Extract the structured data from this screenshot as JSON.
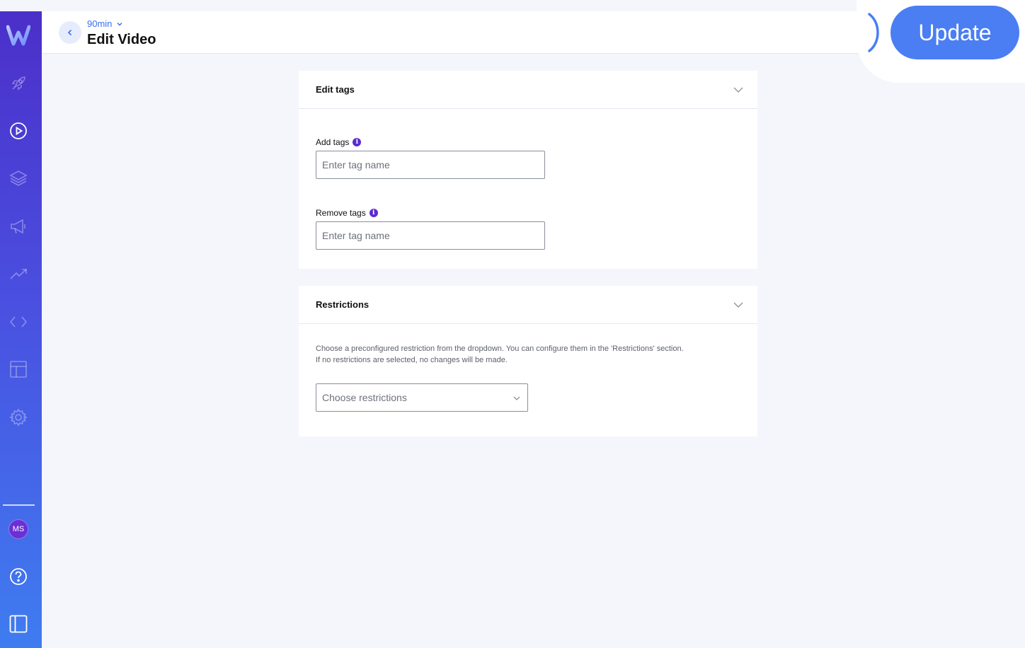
{
  "header": {
    "project": "90min",
    "title": "Edit Video"
  },
  "actions": {
    "update_label": "Update"
  },
  "sidebar": {
    "items": [
      {
        "icon": "rocket-icon"
      },
      {
        "icon": "play-circle-icon",
        "active": true
      },
      {
        "icon": "layers-icon"
      },
      {
        "icon": "megaphone-icon"
      },
      {
        "icon": "trending-up-icon"
      },
      {
        "icon": "code-icon"
      },
      {
        "icon": "layout-icon"
      },
      {
        "icon": "gear-icon"
      }
    ],
    "user_initials": "MS",
    "help_icon": "help-circle-icon",
    "panel_icon": "sidebar-panel-icon"
  },
  "edit_tags": {
    "title": "Edit tags",
    "add_label": "Add tags",
    "add_placeholder": "Enter tag name",
    "remove_label": "Remove tags",
    "remove_placeholder": "Enter tag name"
  },
  "restrictions": {
    "title": "Restrictions",
    "help_line1": "Choose a preconfigured restriction from the dropdown. You can configure them in the 'Restrictions' section.",
    "help_line2": "If no restrictions are selected, no changes will be made.",
    "select_placeholder": "Choose restrictions"
  },
  "colors": {
    "accent": "#4a7ef2",
    "info": "#5b2bd1",
    "sidebar_top": "#4b2fc9",
    "sidebar_bottom": "#3f7cf0"
  }
}
